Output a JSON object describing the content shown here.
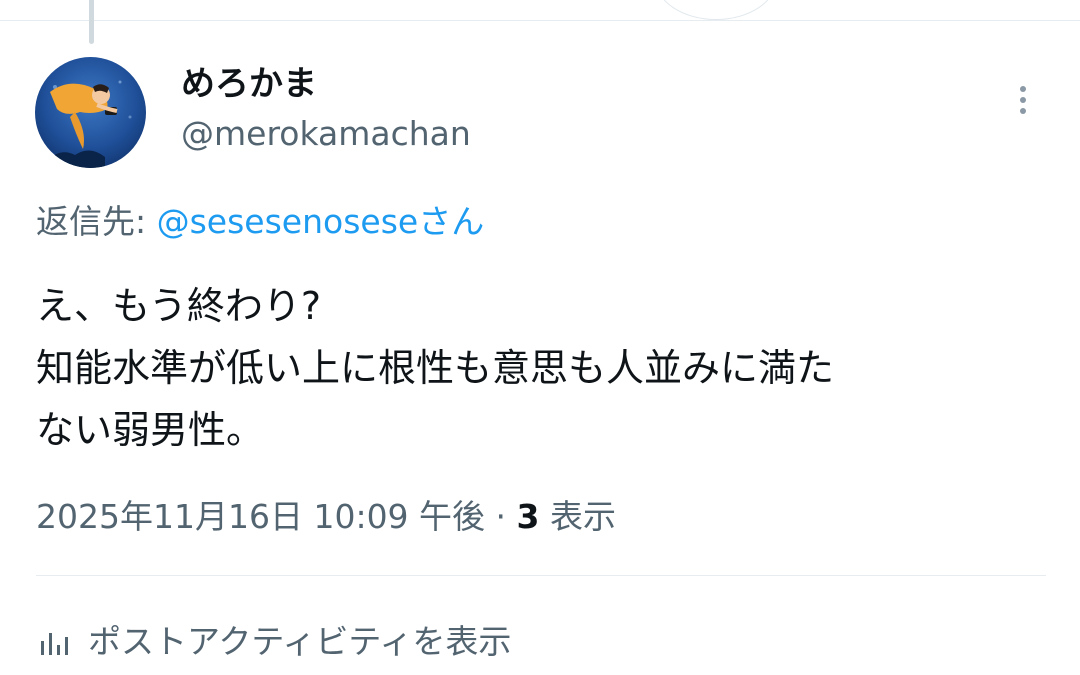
{
  "author": {
    "display_name": "めろかま",
    "handle": "@merokamachan"
  },
  "reply_to": {
    "prefix": "返信先: ",
    "mention": "@sesesenoseseさん"
  },
  "tweet": {
    "lines": [
      "え、もう終わり?",
      "知能水準が低い上に根性も意思も人並みに満た",
      "ない弱男性。"
    ]
  },
  "meta": {
    "timestamp": "2025年11月16日 10:09 午後",
    "separator": " · ",
    "view_count": "3",
    "view_label": " 表示"
  },
  "actions": {
    "post_activity_label": "ポストアクティビティを表示"
  },
  "icons": {
    "more": "more-vertical-icon",
    "activity": "bar-chart-icon"
  },
  "colors": {
    "link": "#1d9bf0",
    "secondary_text": "#536471",
    "primary_text": "#0f1419",
    "divider": "#e6ecf0"
  }
}
